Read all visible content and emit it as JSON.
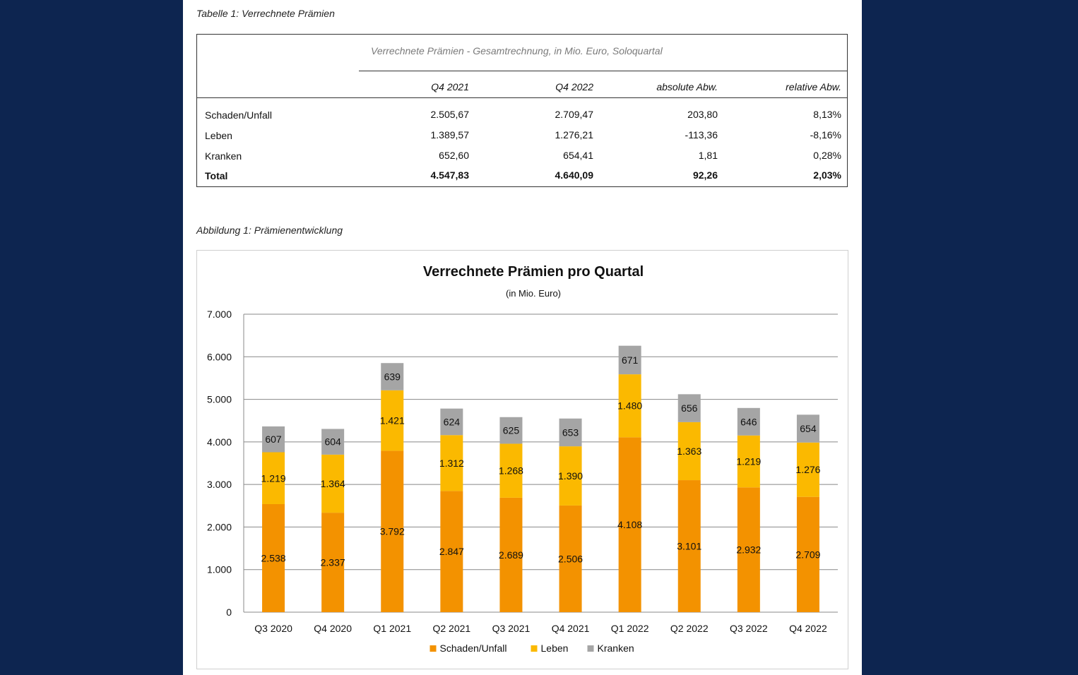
{
  "table_caption": "Tabelle 1: Verrechnete Prämien",
  "figure_caption": "Abbildung 1: Prämienentwicklung",
  "table": {
    "title": "Verrechnete Prämien - Gesamtrechnung, in Mio. Euro, Soloquartal",
    "columns": [
      "Q4 2021",
      "Q4 2022",
      "absolute Abw.",
      "relative Abw."
    ],
    "rows": [
      {
        "label": "Schaden/Unfall",
        "values": [
          "2.505,67",
          "2.709,47",
          "203,80",
          "8,13%"
        ]
      },
      {
        "label": "Leben",
        "values": [
          "1.389,57",
          "1.276,21",
          "-113,36",
          "-8,16%"
        ]
      },
      {
        "label": "Kranken",
        "values": [
          "652,60",
          "654,41",
          "1,81",
          "0,28%"
        ]
      },
      {
        "label": "Total",
        "values": [
          "4.547,83",
          "4.640,09",
          "92,26",
          "2,03%"
        ]
      }
    ]
  },
  "chart_data": {
    "type": "bar",
    "stacked": true,
    "title": "Verrechnete Prämien pro Quartal",
    "subtitle": "(in Mio. Euro)",
    "categories": [
      "Q3 2020",
      "Q4 2020",
      "Q1 2021",
      "Q2 2021",
      "Q3 2021",
      "Q4 2021",
      "Q1 2022",
      "Q2 2022",
      "Q3 2022",
      "Q4 2022"
    ],
    "series": [
      {
        "name": "Schaden/Unfall",
        "color": "#f39200",
        "values": [
          2538,
          2337,
          3792,
          2847,
          2689,
          2506,
          4108,
          3101,
          2932,
          2709
        ],
        "labels": [
          "2.538",
          "2.337",
          "3.792",
          "2.847",
          "2.689",
          "2.506",
          "4.108",
          "3.101",
          "2.932",
          "2.709"
        ]
      },
      {
        "name": "Leben",
        "color": "#fbb900",
        "values": [
          1219,
          1364,
          1421,
          1312,
          1268,
          1390,
          1480,
          1363,
          1219,
          1276
        ],
        "labels": [
          "1.219",
          "1.364",
          "1.421",
          "1.312",
          "1.268",
          "1.390",
          "1.480",
          "1.363",
          "1.219",
          "1.276"
        ]
      },
      {
        "name": "Kranken",
        "color": "#a5a5a5",
        "values": [
          607,
          604,
          639,
          624,
          625,
          653,
          671,
          656,
          646,
          654
        ],
        "labels": [
          "607",
          "604",
          "639",
          "624",
          "625",
          "653",
          "671",
          "656",
          "646",
          "654"
        ]
      }
    ],
    "ylim": [
      0,
      7000
    ],
    "yticks": [
      0,
      1000,
      2000,
      3000,
      4000,
      5000,
      6000,
      7000
    ],
    "ytick_labels": [
      "0",
      "1.000",
      "2.000",
      "3.000",
      "4.000",
      "5.000",
      "6.000",
      "7.000"
    ],
    "grid": true,
    "legend_position": "bottom"
  }
}
